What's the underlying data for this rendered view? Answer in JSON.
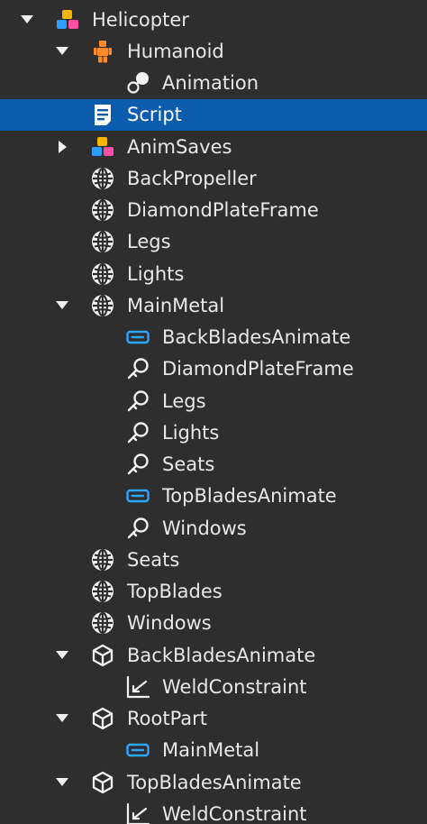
{
  "colors": {
    "background": "#2e2e2e",
    "selected_row": "#0b5cad",
    "text": "#e8e8e8",
    "text_selected": "#ffffff",
    "expander": "#f0f0f0",
    "model_yellow": "#f7b500",
    "model_pink": "#ff4fa3",
    "model_blue": "#2f9cff",
    "humanoid_orange": "#ff8a2a",
    "motor_blue": "#2aa8ff"
  },
  "explorer": {
    "items": [
      {
        "label": "Helicopter",
        "depth": 0,
        "icon": "model-icon",
        "expander": "expanded",
        "selected": false
      },
      {
        "label": "Humanoid",
        "depth": 1,
        "icon": "humanoid-icon",
        "expander": "expanded",
        "selected": false
      },
      {
        "label": "Animation",
        "depth": 2,
        "icon": "animation-icon",
        "expander": "none",
        "selected": false
      },
      {
        "label": "Script",
        "depth": 1,
        "icon": "script-icon",
        "expander": "none",
        "selected": true
      },
      {
        "label": "AnimSaves",
        "depth": 1,
        "icon": "model-icon",
        "expander": "collapsed",
        "selected": false
      },
      {
        "label": "BackPropeller",
        "depth": 1,
        "icon": "union-icon",
        "expander": "none",
        "selected": false
      },
      {
        "label": "DiamondPlateFrame",
        "depth": 1,
        "icon": "union-icon",
        "expander": "none",
        "selected": false
      },
      {
        "label": "Legs",
        "depth": 1,
        "icon": "union-icon",
        "expander": "none",
        "selected": false
      },
      {
        "label": "Lights",
        "depth": 1,
        "icon": "union-icon",
        "expander": "none",
        "selected": false
      },
      {
        "label": "MainMetal",
        "depth": 1,
        "icon": "union-icon",
        "expander": "expanded",
        "selected": false
      },
      {
        "label": "BackBladesAnimate",
        "depth": 2,
        "icon": "motor6d-icon",
        "expander": "none",
        "selected": false
      },
      {
        "label": "DiamondPlateFrame",
        "depth": 2,
        "icon": "weld-icon",
        "expander": "none",
        "selected": false
      },
      {
        "label": "Legs",
        "depth": 2,
        "icon": "weld-icon",
        "expander": "none",
        "selected": false
      },
      {
        "label": "Lights",
        "depth": 2,
        "icon": "weld-icon",
        "expander": "none",
        "selected": false
      },
      {
        "label": "Seats",
        "depth": 2,
        "icon": "weld-icon",
        "expander": "none",
        "selected": false
      },
      {
        "label": "TopBladesAnimate",
        "depth": 2,
        "icon": "motor6d-icon",
        "expander": "none",
        "selected": false
      },
      {
        "label": "Windows",
        "depth": 2,
        "icon": "weld-icon",
        "expander": "none",
        "selected": false
      },
      {
        "label": "Seats",
        "depth": 1,
        "icon": "union-icon",
        "expander": "none",
        "selected": false
      },
      {
        "label": "TopBlades",
        "depth": 1,
        "icon": "union-icon",
        "expander": "none",
        "selected": false
      },
      {
        "label": "Windows",
        "depth": 1,
        "icon": "union-icon",
        "expander": "none",
        "selected": false
      },
      {
        "label": "BackBladesAnimate",
        "depth": 1,
        "icon": "part-icon",
        "expander": "expanded",
        "selected": false
      },
      {
        "label": "WeldConstraint",
        "depth": 2,
        "icon": "weld-constraint-icon",
        "expander": "none",
        "selected": false
      },
      {
        "label": "RootPart",
        "depth": 1,
        "icon": "part-icon",
        "expander": "expanded",
        "selected": false
      },
      {
        "label": "MainMetal",
        "depth": 2,
        "icon": "motor6d-icon",
        "expander": "none",
        "selected": false
      },
      {
        "label": "TopBladesAnimate",
        "depth": 1,
        "icon": "part-icon",
        "expander": "expanded",
        "selected": false
      },
      {
        "label": "WeldConstraint",
        "depth": 2,
        "icon": "weld-constraint-icon",
        "expander": "none",
        "selected": false
      }
    ]
  }
}
